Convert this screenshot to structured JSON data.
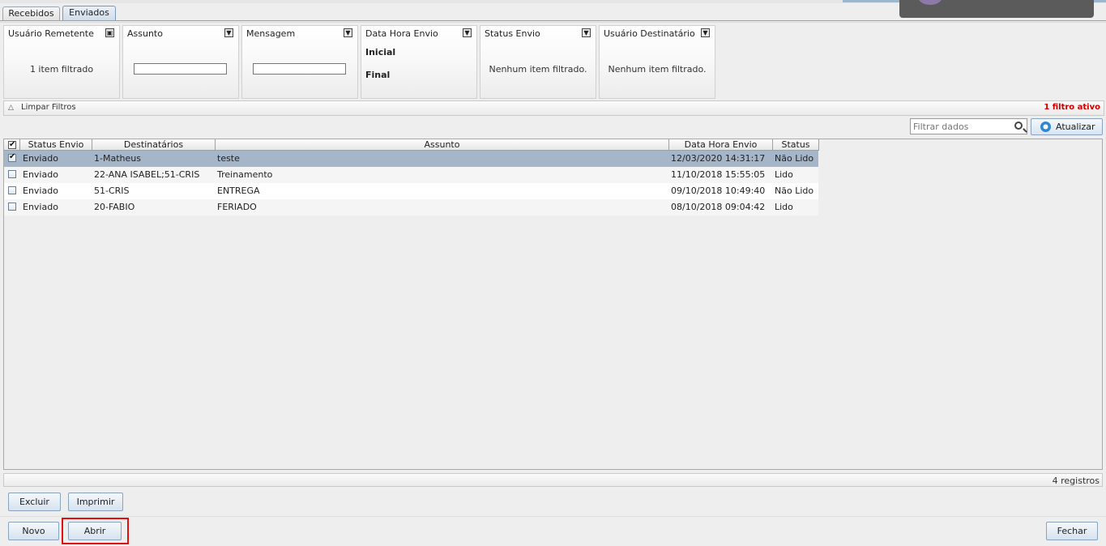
{
  "tabs": [
    "Recebidos",
    "Enviados"
  ],
  "active_tab": "Enviados",
  "filters": {
    "remetente": {
      "title": "Usuário Remetente",
      "status": "1 item filtrado"
    },
    "assunto": {
      "title": "Assunto",
      "value": ""
    },
    "mensagem": {
      "title": "Mensagem",
      "value": ""
    },
    "data_hora": {
      "title": "Data Hora Envio",
      "inicial": "Inicial",
      "final": "Final"
    },
    "status_envio": {
      "title": "Status Envio",
      "status": "Nenhum item filtrado."
    },
    "destinatario": {
      "title": "Usuário Destinatário",
      "status": "Nenhum item filtrado."
    }
  },
  "filter_bar": {
    "clear_label": "Limpar Filtros",
    "active_label": "1 filtro ativo"
  },
  "search": {
    "placeholder": "Filtrar dados"
  },
  "refresh_label": "Atualizar",
  "table": {
    "columns": [
      "Status Envio",
      "Destinatários",
      "Assunto",
      "Data Hora Envio",
      "Status"
    ],
    "rows": [
      {
        "checked": true,
        "status_envio": "Enviado",
        "destinatarios": "1-Matheus",
        "assunto": "teste",
        "data_hora": "12/03/2020 14:31:17",
        "status": "Não Lido"
      },
      {
        "checked": false,
        "status_envio": "Enviado",
        "destinatarios": "22-ANA ISABEL;51-CRIS",
        "assunto": "Treinamento",
        "data_hora": "11/10/2018 15:55:05",
        "status": "Lido"
      },
      {
        "checked": false,
        "status_envio": "Enviado",
        "destinatarios": "51-CRIS",
        "assunto": "ENTREGA",
        "data_hora": "09/10/2018 10:49:40",
        "status": "Não Lido"
      },
      {
        "checked": false,
        "status_envio": "Enviado",
        "destinatarios": "20-FABIO",
        "assunto": "FERIADO",
        "data_hora": "08/10/2018 09:04:42",
        "status": "Lido"
      }
    ]
  },
  "record_count": "4 registros",
  "buttons": {
    "excluir": "Excluir",
    "imprimir": "Imprimir",
    "novo": "Novo",
    "abrir": "Abrir",
    "fechar": "Fechar"
  },
  "icons": {
    "lock": "lock-icon",
    "filter": "filter-icon",
    "search": "search-icon",
    "refresh": "refresh-icon"
  },
  "colors": {
    "selected_row": "#a6b6c9",
    "active_filter_text": "#cc0000",
    "highlight_border": "#e01010"
  }
}
